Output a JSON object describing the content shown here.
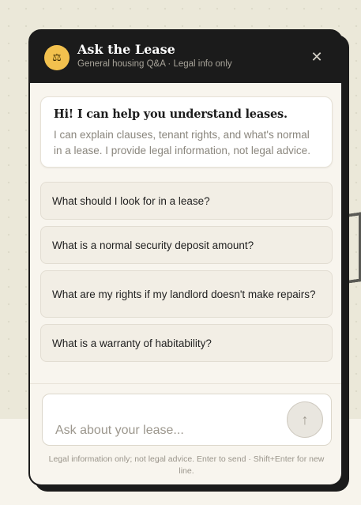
{
  "header": {
    "logo_icon": "⚖",
    "title": "Ask the Lease",
    "subtitle": "General housing Q&A · Legal info only",
    "close_icon": "✕"
  },
  "welcome": {
    "heading": "Hi! I can help you understand leases.",
    "text": "I can explain clauses, tenant rights, and what's normal in a lease. I provide legal information, not legal advice."
  },
  "suggestions": [
    "What should I look for in a lease?",
    "What is a normal security deposit amount?",
    "What are my rights if my landlord doesn't make repairs?",
    "What is a warranty of habitability?"
  ],
  "composer": {
    "placeholder": "Ask about your lease...",
    "send_icon": "↑"
  },
  "footnote": "Legal information only; not legal advice. Enter to send · Shift+Enter for new line.",
  "colors": {
    "header_bg": "#1b1b1b",
    "accent": "#f2c14e",
    "panel_bg": "#f8f5ee"
  }
}
